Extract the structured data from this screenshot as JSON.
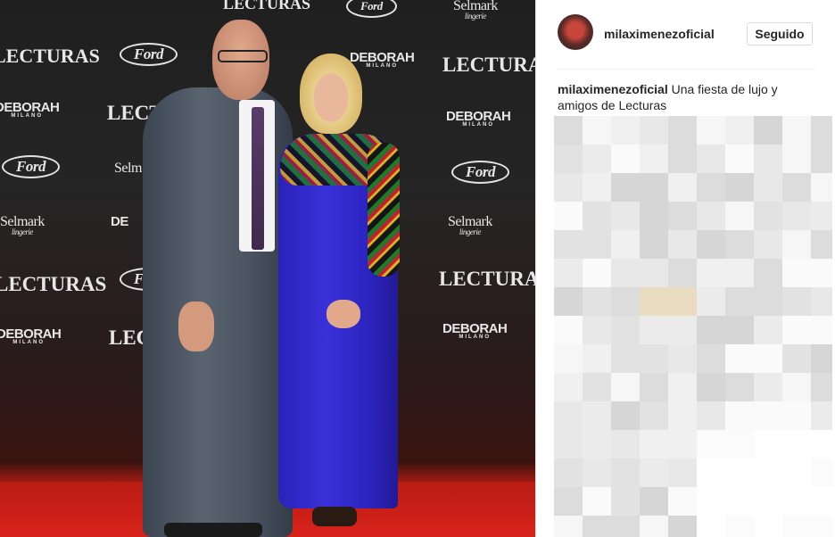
{
  "photo": {
    "backdrop_logos": {
      "lecturas": "LECTURAS",
      "lectur": "LECTUR",
      "lectu": "LECTU",
      "deborah": "DEBORAH",
      "deborah_sub": "MILANO",
      "ford": "Ford",
      "selmark": "Selmark",
      "selmark_sub": "lingerie",
      "selm": "Selm",
      "de": "DE"
    },
    "colors": {
      "backdrop": "#232323",
      "carpet": "#d0211a",
      "dress": "#3028cc",
      "suit": "#4f5866"
    }
  },
  "post": {
    "avatar_icon": "profile-avatar",
    "username": "milaximenezoficial",
    "follow_button": "Seguido",
    "caption_user": "milaximenezoficial",
    "caption_text": "Una fiesta de lujo y amigos de Lecturas"
  },
  "comments_area": {
    "state": "pixelated"
  }
}
